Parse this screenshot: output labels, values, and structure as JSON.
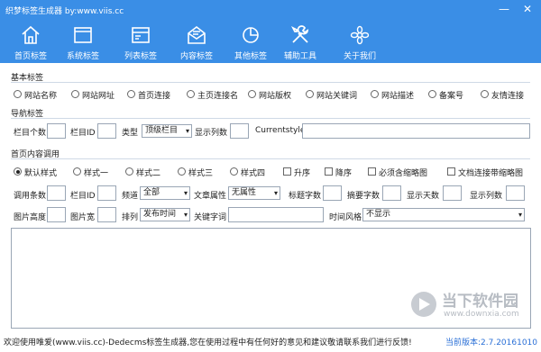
{
  "window": {
    "title": "织梦标签生成器  by:www.viis.cc",
    "minimize_glyph": "—",
    "close_glyph": "✕"
  },
  "toolbar": {
    "items": [
      {
        "label": "首页标签",
        "icon": "home-icon"
      },
      {
        "label": "系统标签",
        "icon": "window-icon"
      },
      {
        "label": "列表标签",
        "icon": "list-card-icon"
      },
      {
        "label": "内容标签",
        "icon": "envelope-icon"
      },
      {
        "label": "其他标签",
        "icon": "pie-chart-icon"
      },
      {
        "label": "辅助工具",
        "icon": "tools-icon"
      },
      {
        "label": "关于我们",
        "icon": "flower-icon"
      }
    ]
  },
  "basic": {
    "heading": "基本标签",
    "options": [
      "网站名称",
      "网站网址",
      "首页连接",
      "主页连接名",
      "网站版权",
      "网站关键词",
      "网站描述",
      "备案号",
      "友情连接"
    ]
  },
  "nav": {
    "heading": "导航标签",
    "col_count_label": "栏目个数",
    "col_id_label": "栏目ID",
    "type_label": "类型",
    "type_value": "顶级栏目",
    "display_cols_label": "显示列数",
    "current_style_label": "Currentstyle"
  },
  "home_content": {
    "heading": "首页内容调用",
    "styles": [
      "默认样式",
      "样式一",
      "样式二",
      "样式三",
      "样式四"
    ],
    "checks": [
      "升序",
      "降序",
      "必须含缩略图",
      "文档连接带缩略图"
    ],
    "count_label": "调用条数",
    "col_id_label": "栏目ID",
    "channel_label": "频道",
    "channel_value": "全部",
    "attr_label": "文章属性",
    "attr_value": "无属性",
    "title_len_label": "标题字数",
    "summary_len_label": "摘要字数",
    "days_label": "显示天数",
    "cols_label": "显示列数",
    "img_height_label": "图片高度",
    "img_width_label": "图片宽",
    "sort_label": "排列",
    "sort_value": "发布时间",
    "keyword_label": "关键字词",
    "time_style_label": "时间风格",
    "time_style_value": "不显示"
  },
  "status": {
    "message": "欢迎使用唯爱(www.viis.cc)-Dedecms标签生成器,您在使用过程中有任何好的意见和建议敬请联系我们进行反馈!",
    "version": "当前版本:2.7.20161010"
  },
  "watermark": {
    "brand": "当下软件园",
    "url": "www.downxia.com"
  }
}
